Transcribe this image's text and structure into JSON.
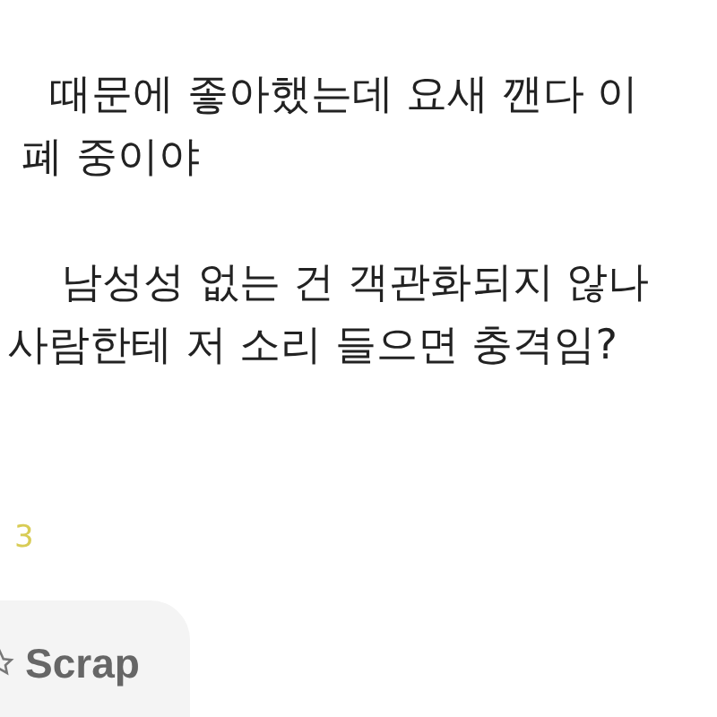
{
  "post_lines": [
    "때문에 좋아했는데 요새 깬다 이",
    "폐 중이야",
    "남성성 없는 건 객관화되지 않나",
    "사람한테 저 소리 들으면 충격임?"
  ],
  "like_count": "3",
  "scrap_button": {
    "label": "Scrap"
  }
}
